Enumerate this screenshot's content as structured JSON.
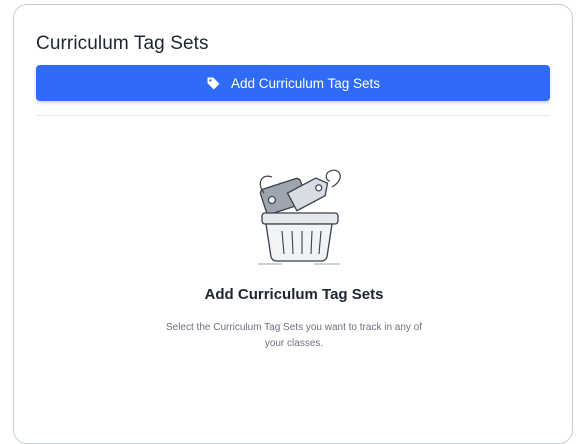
{
  "panel": {
    "title": "Curriculum Tag Sets",
    "add_button_label": "Add Curriculum Tag Sets"
  },
  "empty_state": {
    "illustration": "basket-with-tags-illustration",
    "title": "Add Curriculum Tag Sets",
    "description": "Select the Curriculum Tag Sets you want to track in any of your classes."
  },
  "colors": {
    "primary_button": "#2f6bf6",
    "title_text": "#1e2430",
    "muted_text": "#6b7280",
    "border": "#c9ccd3"
  },
  "icons": {
    "button_icon": "tag-icon"
  }
}
